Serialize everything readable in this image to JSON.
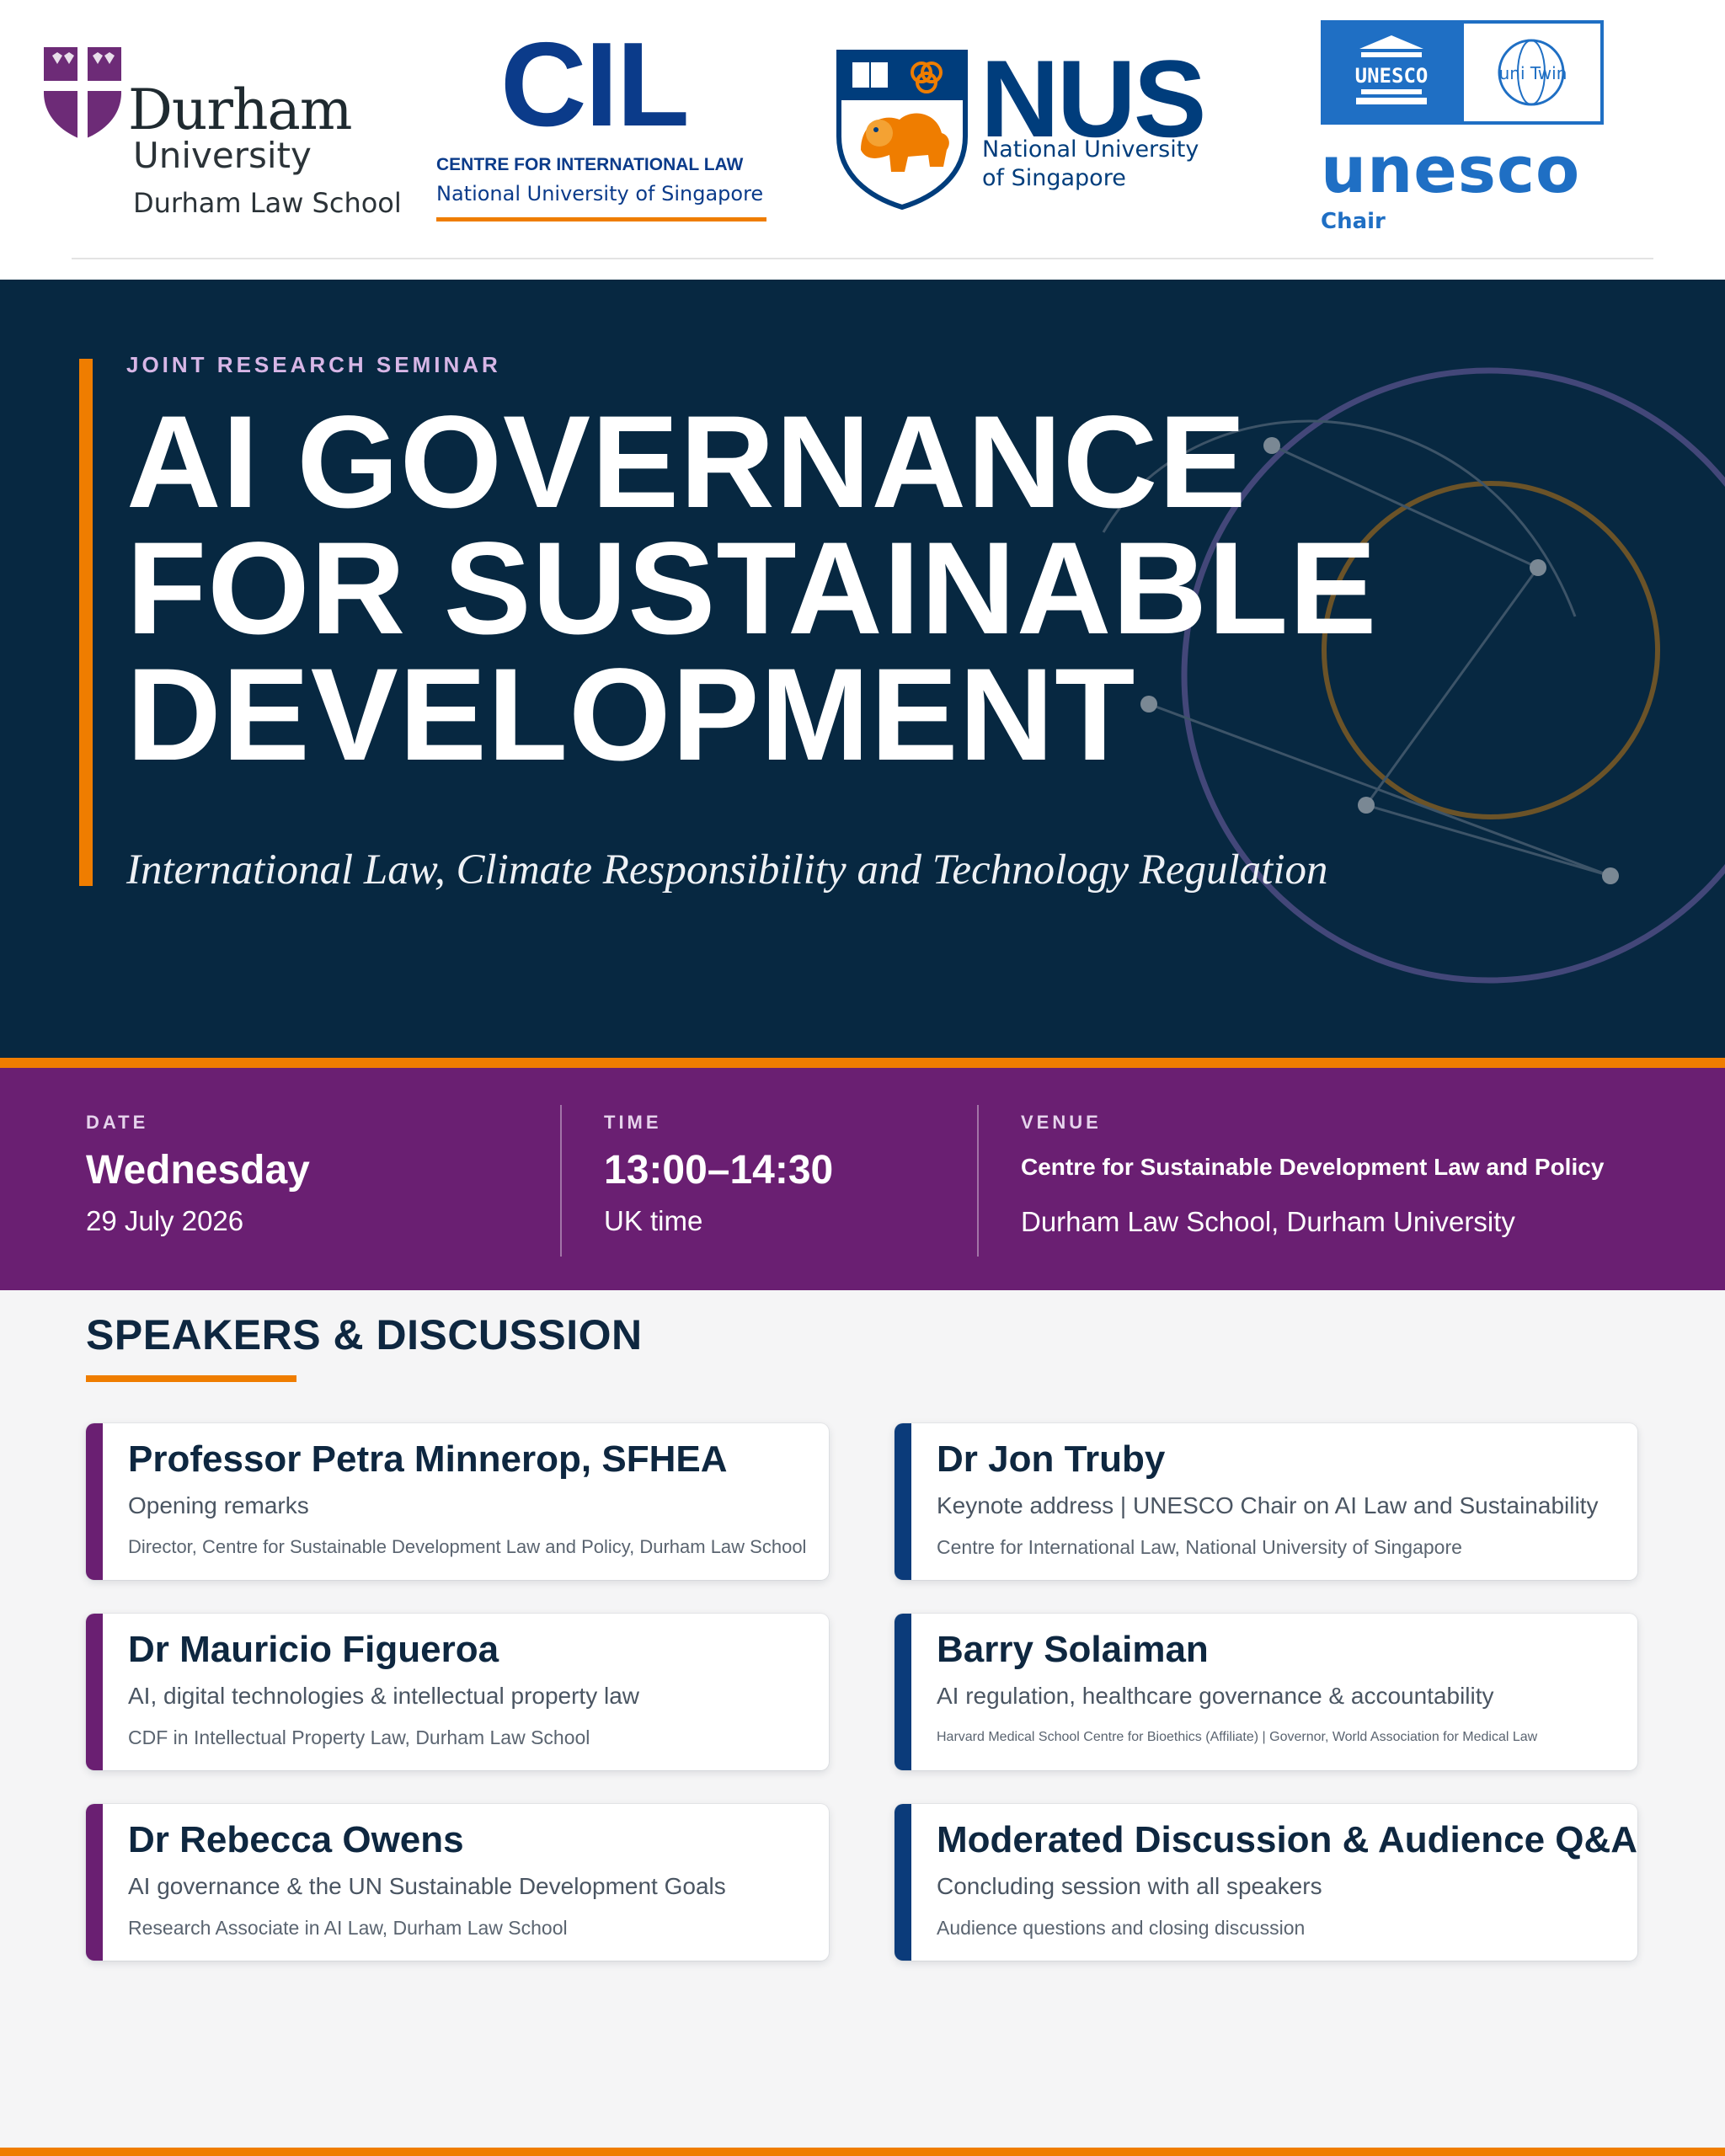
{
  "logos": {
    "durham": {
      "name": "Durham",
      "university": "University",
      "school": "Durham Law School"
    },
    "cil": {
      "mark": "CIL",
      "line1": "CENTRE FOR INTERNATIONAL LAW",
      "line2": "National University of Singapore"
    },
    "nus": {
      "mark": "NUS",
      "line1": "National University",
      "line2": "of Singapore"
    },
    "unesco": {
      "word": "unesco",
      "chair": "Chair",
      "box_text": "UNESCO",
      "twin_text": "uni Twin"
    }
  },
  "hero": {
    "eyebrow": "JOINT RESEARCH SEMINAR",
    "title_lines": [
      "AI GOVERNANCE",
      "FOR SUSTAINABLE",
      "DEVELOPMENT"
    ],
    "subtitle": "International Law, Climate Responsibility and Technology Regulation"
  },
  "details": {
    "date": {
      "label": "DATE",
      "main": "Wednesday",
      "sub": "29 July 2026"
    },
    "time": {
      "label": "TIME",
      "main": "13:00–14:30",
      "sub": "UK time"
    },
    "venue": {
      "label": "VENUE",
      "main": "Centre for Sustainable Development Law and Policy",
      "sub": "Durham Law School, Durham University"
    }
  },
  "speakers": {
    "heading": "SPEAKERS & DISCUSSION",
    "items": [
      {
        "name": "Professor Petra Minnerop, SFHEA",
        "role": "Opening remarks",
        "affiliation": "Director, Centre for Sustainable Development Law and Policy, Durham Law School"
      },
      {
        "name": "Dr Jon Truby",
        "role": "Keynote address | UNESCO Chair on AI Law and Sustainability",
        "affiliation": "Centre for International Law, National University of Singapore"
      },
      {
        "name": "Dr Mauricio Figueroa",
        "role": "AI, digital technologies & intellectual property law",
        "affiliation": "CDF in Intellectual Property Law, Durham Law School"
      },
      {
        "name": "Barry Solaiman",
        "role": "AI regulation, healthcare governance & accountability",
        "affiliation": "Harvard Medical School Centre for Bioethics (Affiliate) | Governor, World Association for Medical Law"
      },
      {
        "name": "Dr Rebecca Owens",
        "role": "AI governance & the UN Sustainable Development Goals",
        "affiliation": "Research Associate in AI Law, Durham Law School"
      },
      {
        "name": "Moderated Discussion & Audience Q&A",
        "role": "Concluding session with all speakers",
        "affiliation": "Audience questions and closing discussion"
      }
    ]
  },
  "colors": {
    "navy": "#072841",
    "purple": "#6a1f72",
    "orange": "#ef7d00",
    "nus_blue": "#003d7c",
    "unesco_blue": "#1f6fc4"
  }
}
